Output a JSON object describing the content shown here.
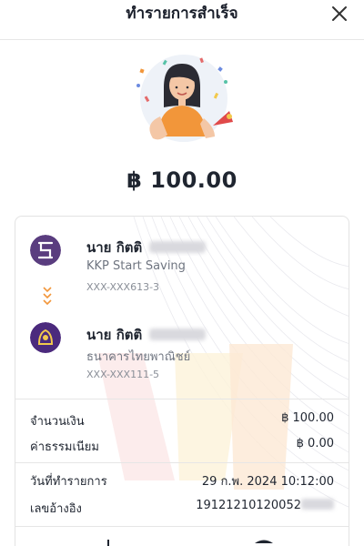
{
  "header": {
    "title": "ทำรายการสำเร็จ",
    "close_icon": "close-icon"
  },
  "amount": "฿ 100.00",
  "colors": {
    "from_bank": "#5a3d7f",
    "to_bank": "#4b2a7d",
    "accent_orange": "#f2963a"
  },
  "sender": {
    "name": "นาย กิตติ",
    "bank": "KKP Start Saving",
    "account": "XXX-XXX613-3",
    "logo_icon": "kkp-logo-icon"
  },
  "receiver": {
    "name": "นาย กิตติ",
    "bank": "ธนาคารไทยพาณิชย์",
    "account": "XXX-XXX111-5",
    "logo_icon": "scb-logo-icon"
  },
  "details": {
    "amount_label": "จำนวนเงิน",
    "amount_value": "฿ 100.00",
    "fee_label": "ค่าธรรมเนียม",
    "fee_value": "฿ 0.00",
    "date_label": "วันที่ทำรายการ",
    "date_value": "29 ก.พ. 2024  10:12:00",
    "ref_label": "เลขอ้างอิง",
    "ref_value": "19121210120052"
  }
}
